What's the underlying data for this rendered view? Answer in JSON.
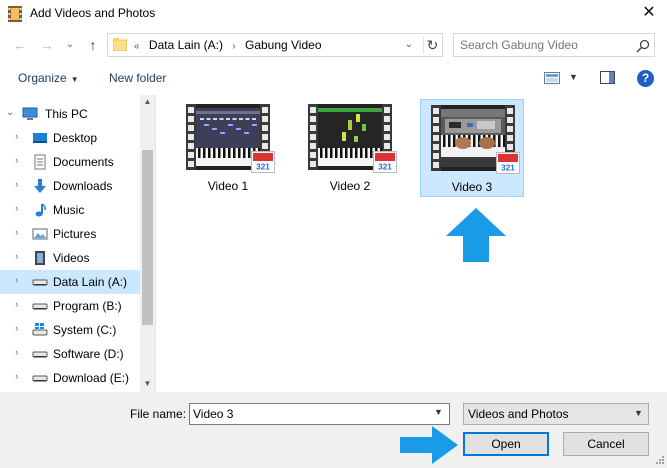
{
  "window": {
    "title": "Add Videos and Photos",
    "close_glyph": "✕"
  },
  "nav_buttons": {
    "back": "←",
    "forward": "→",
    "recent_dropdown": "⌄",
    "up": "↑"
  },
  "address_bar": {
    "overflow_marker": "«",
    "crumbs": [
      "Data Lain (A:)",
      "Gabung Video"
    ],
    "separator": "›",
    "dropdown_glyph": "⌄",
    "refresh_glyph": "↻"
  },
  "search": {
    "placeholder": "Search Gabung Video"
  },
  "toolbar": {
    "organize_label": "Organize",
    "new_folder_label": "New folder",
    "help_glyph": "?"
  },
  "navigation": {
    "items": [
      {
        "label": "This PC",
        "icon": "computer-icon"
      },
      {
        "label": "Desktop",
        "icon": "desktop-icon"
      },
      {
        "label": "Documents",
        "icon": "documents-icon"
      },
      {
        "label": "Downloads",
        "icon": "downloads-icon"
      },
      {
        "label": "Music",
        "icon": "music-icon"
      },
      {
        "label": "Pictures",
        "icon": "pictures-icon"
      },
      {
        "label": "Videos",
        "icon": "videos-icon"
      },
      {
        "label": "Data Lain (A:)",
        "icon": "drive-icon",
        "selected": true
      },
      {
        "label": "Program (B:)",
        "icon": "drive-icon"
      },
      {
        "label": "System (C:)",
        "icon": "windows-drive-icon"
      },
      {
        "label": "Software (D:)",
        "icon": "drive-icon"
      },
      {
        "label": "Download (E:)",
        "icon": "drive-icon"
      }
    ]
  },
  "files": [
    {
      "name": "Video 1",
      "selected": false,
      "thumbnail": "piano-roll-editor"
    },
    {
      "name": "Video 2",
      "selected": false,
      "thumbnail": "falling-notes-piano"
    },
    {
      "name": "Video 3",
      "selected": true,
      "thumbnail": "hands-on-keyboard"
    }
  ],
  "badge_text": "321",
  "file_name": {
    "label": "File name:",
    "value": "Video 3"
  },
  "file_type": {
    "value": "Videos and Photos"
  },
  "buttons": {
    "open": "Open",
    "cancel": "Cancel"
  },
  "colors": {
    "selection": "#cce8ff",
    "accent": "#0078d7",
    "arrow": "#1a9be8"
  }
}
